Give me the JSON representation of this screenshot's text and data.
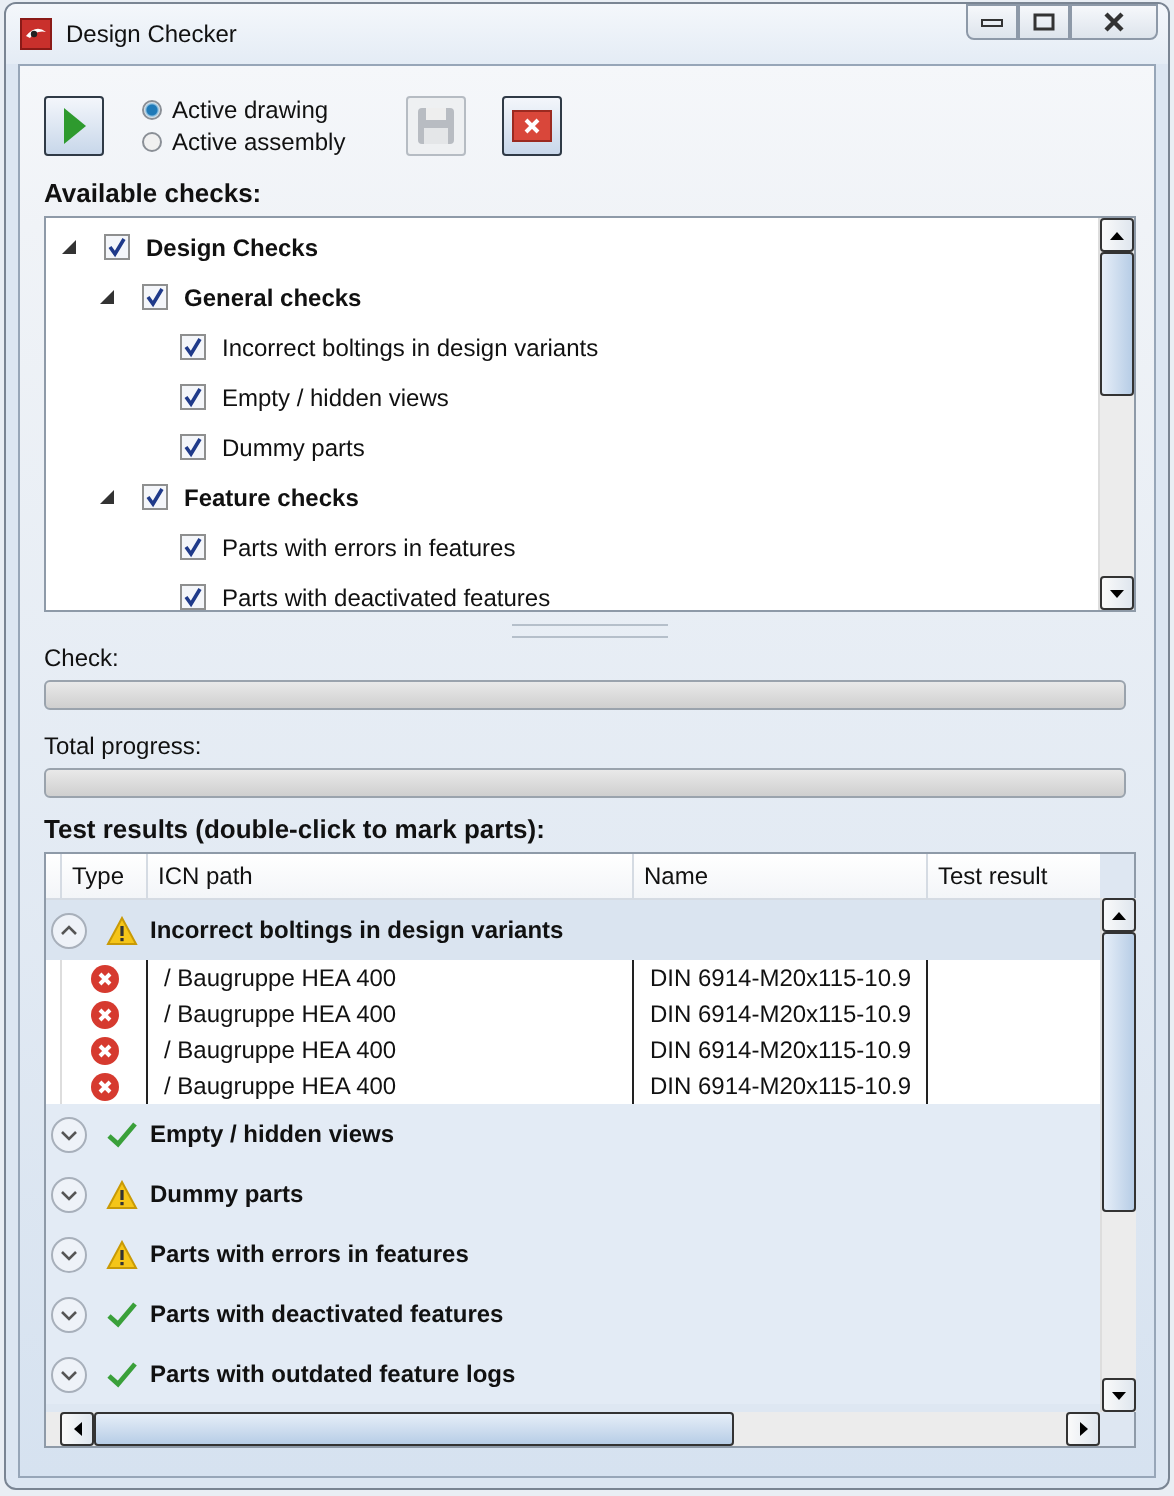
{
  "window": {
    "title": "Design Checker"
  },
  "toolbar": {
    "scope": [
      {
        "label": "Active drawing",
        "selected": true
      },
      {
        "label": "Active assembly",
        "selected": false
      }
    ],
    "save_disabled": true
  },
  "available_checks": {
    "label": "Available checks:",
    "tree": [
      {
        "label": "Design Checks",
        "checked": true,
        "expanded": true,
        "children": [
          {
            "label": "General checks",
            "checked": true,
            "expanded": true,
            "children": [
              {
                "label": "Incorrect boltings in design variants",
                "checked": true
              },
              {
                "label": "Empty / hidden views",
                "checked": true
              },
              {
                "label": "Dummy parts",
                "checked": true
              }
            ]
          },
          {
            "label": "Feature checks",
            "checked": true,
            "expanded": true,
            "children": [
              {
                "label": "Parts with errors in features",
                "checked": true
              },
              {
                "label": "Parts with deactivated features",
                "checked": true
              }
            ]
          }
        ]
      }
    ]
  },
  "progress": [
    {
      "label": "Check:",
      "level": 0
    },
    {
      "label": "Total progress:",
      "level": 0
    }
  ],
  "results": {
    "label": "Test results (double-click to mark parts):",
    "columns": [
      "Type",
      "ICN path",
      "Name",
      "Test result"
    ],
    "groups": [
      {
        "title": "Incorrect boltings in design variants",
        "kind": "warning",
        "expanded": true,
        "rows": [
          {
            "kind": "error",
            "icn_path": "/ Baugruppe HEA 400",
            "name": "DIN 6914-M20x115-10.9"
          },
          {
            "kind": "error",
            "icn_path": "/ Baugruppe HEA 400",
            "name": "DIN 6914-M20x115-10.9"
          },
          {
            "kind": "error",
            "icn_path": "/ Baugruppe HEA 400",
            "name": "DIN 6914-M20x115-10.9"
          },
          {
            "kind": "error",
            "icn_path": "/ Baugruppe HEA 400",
            "name": "DIN 6914-M20x115-10.9"
          }
        ]
      },
      {
        "title": "Empty / hidden views",
        "kind": "ok",
        "expanded": false
      },
      {
        "title": "Dummy parts",
        "kind": "warning",
        "expanded": false
      },
      {
        "title": "Parts with errors in features",
        "kind": "warning",
        "expanded": false
      },
      {
        "title": "Parts with deactivated features",
        "kind": "ok",
        "expanded": false
      },
      {
        "title": "Parts with outdated feature logs",
        "kind": "ok",
        "expanded": false
      }
    ]
  }
}
